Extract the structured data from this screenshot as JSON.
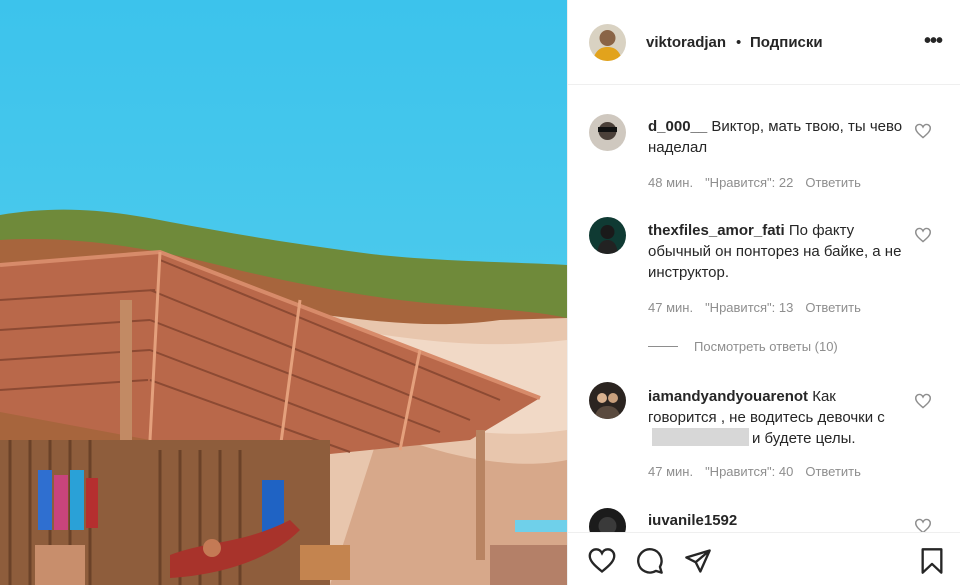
{
  "post": {
    "author": "viktoradjan",
    "separator": "•",
    "follow_label": "Подписки",
    "more_label": "•••"
  },
  "comments": [
    {
      "username": "d_000__",
      "text": " Виктор, мать твою, ты чево наделал",
      "time": "48 мин.",
      "likes": "\"Нравится\": 22",
      "reply": "Ответить"
    },
    {
      "username": "thexfiles_amor_fati",
      "text": " По факту обычный он понторез на байке, а не инструктор.",
      "time": "47 мин.",
      "likes": "\"Нравится\": 13",
      "reply": "Ответить"
    },
    {
      "username": "iamandyandyouarenot",
      "text_before": " Как говорится , не водитесь девочки с",
      "text_after": "и будете целы.",
      "time": "47 мин.",
      "likes": "\"Нравится\": 40",
      "reply": "Ответить"
    },
    {
      "username": "iuvanile1592"
    }
  ],
  "view_replies": "Посмотреть ответы (10)",
  "icons": {
    "like": "heart-icon",
    "comment": "comment-icon",
    "share": "share-icon",
    "save": "bookmark-icon",
    "more": "more-icon"
  },
  "colors": {
    "sky": "#35c4ea",
    "roof": "#b9684a",
    "text": "#262626",
    "meta": "#8e8e8e",
    "divider": "#efefef"
  }
}
